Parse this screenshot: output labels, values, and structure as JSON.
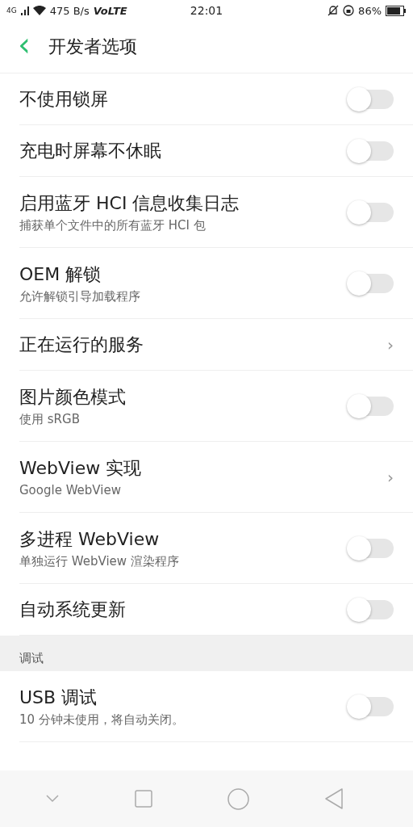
{
  "status_bar": {
    "network": "4G",
    "speed": "475 B/s",
    "volte": "VoLTE",
    "time": "22:01",
    "battery_text": "86%"
  },
  "header": {
    "back": "‹",
    "title": "开发者选项"
  },
  "items": [
    {
      "kind": "toggle",
      "title": "不使用锁屏",
      "on": false
    },
    {
      "kind": "toggle",
      "title": "充电时屏幕不休眠",
      "on": false
    },
    {
      "kind": "toggle",
      "title": "启用蓝牙 HCI 信息收集日志",
      "subtitle": "捕获单个文件中的所有蓝牙 HCI 包",
      "on": false
    },
    {
      "kind": "toggle",
      "title": "OEM 解锁",
      "subtitle": "允许解锁引导加载程序",
      "on": false
    },
    {
      "kind": "link",
      "title": "正在运行的服务",
      "chevron": "›"
    },
    {
      "kind": "toggle",
      "title": "图片颜色模式",
      "subtitle": "使用 sRGB",
      "on": false
    },
    {
      "kind": "link",
      "title": "WebView 实现",
      "subtitle": "Google WebView",
      "chevron": "›"
    },
    {
      "kind": "toggle",
      "title": "多进程 WebView",
      "subtitle": "单独运行 WebView 渲染程序",
      "on": false
    },
    {
      "kind": "toggle",
      "title": "自动系统更新",
      "on": false
    },
    {
      "kind": "section",
      "title": "调试"
    },
    {
      "kind": "toggle",
      "title": "USB 调试",
      "subtitle": "10 分钟未使用，将自动关闭。",
      "on": false
    }
  ]
}
